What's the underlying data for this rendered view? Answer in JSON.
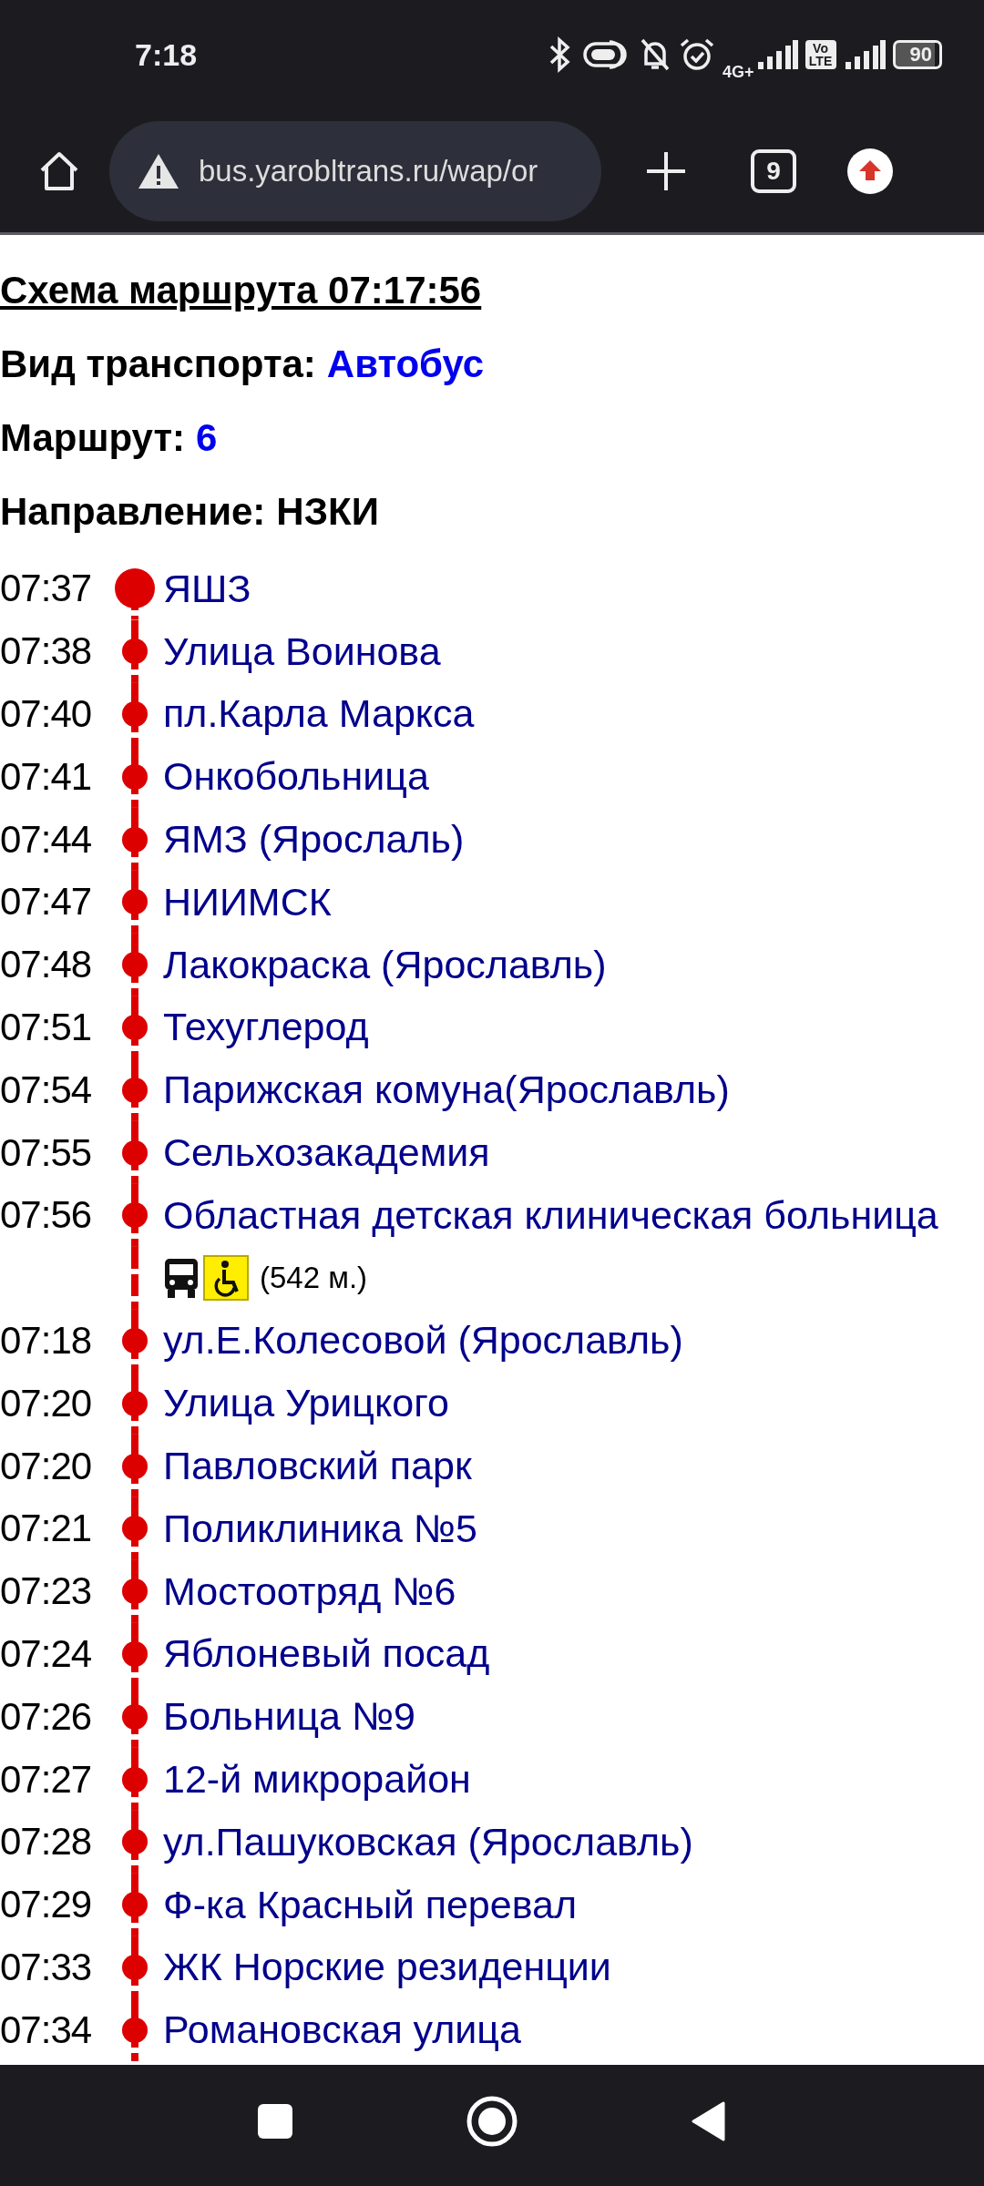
{
  "status_bar": {
    "time": "7:18",
    "network": "4G+",
    "volte": "Vo LTE",
    "battery": "90"
  },
  "browser": {
    "url": "bus.yarobltrans.ru/wap/or",
    "tab_count": "9"
  },
  "page": {
    "title": "Схема маршрута 07:17:56",
    "fields": [
      {
        "label": "Вид транспорта:",
        "value": "Автобус",
        "link": true
      },
      {
        "label": "Маршрут:",
        "value": "6",
        "link": true
      },
      {
        "label": "Направление:",
        "value": "НЗКИ",
        "link": false
      }
    ],
    "stops": [
      {
        "kind": "terminal",
        "time": "07:37",
        "name": "ЯШЗ"
      },
      {
        "kind": "stop",
        "time": "07:38",
        "name": "Улица Воинова"
      },
      {
        "kind": "stop",
        "time": "07:40",
        "name": "пл.Карла Маркса"
      },
      {
        "kind": "stop",
        "time": "07:41",
        "name": "Онкобольница"
      },
      {
        "kind": "stop",
        "time": "07:44",
        "name": "ЯМЗ (Ярослаль)"
      },
      {
        "kind": "stop",
        "time": "07:47",
        "name": "НИИМСК"
      },
      {
        "kind": "stop",
        "time": "07:48",
        "name": "Лакокраска (Ярославль)"
      },
      {
        "kind": "stop",
        "time": "07:51",
        "name": "Техуглерод"
      },
      {
        "kind": "stop",
        "time": "07:54",
        "name": "Парижская комуна(Ярославль)"
      },
      {
        "kind": "stop",
        "time": "07:55",
        "name": "Сельхозакадемия"
      },
      {
        "kind": "stop",
        "time": "07:56",
        "name": "Областная детская клиническая больница"
      },
      {
        "kind": "vehicle",
        "accessible": true,
        "distance": "(542 м.)"
      },
      {
        "kind": "stop",
        "time": "07:18",
        "name": "ул.Е.Колесовой (Ярославль)"
      },
      {
        "kind": "stop",
        "time": "07:20",
        "name": "Улица Урицкого"
      },
      {
        "kind": "stop",
        "time": "07:20",
        "name": "Павловский парк"
      },
      {
        "kind": "stop",
        "time": "07:21",
        "name": "Поликлиника №5"
      },
      {
        "kind": "stop",
        "time": "07:23",
        "name": "Мостоотряд №6"
      },
      {
        "kind": "stop",
        "time": "07:24",
        "name": "Яблоневый посад"
      },
      {
        "kind": "stop",
        "time": "07:26",
        "name": "Больница №9"
      },
      {
        "kind": "stop",
        "time": "07:27",
        "name": "12-й микрорайон"
      },
      {
        "kind": "stop",
        "time": "07:28",
        "name": "ул.Пашуковская (Ярославль)"
      },
      {
        "kind": "stop",
        "time": "07:29",
        "name": "Ф-ка Красный перевал"
      },
      {
        "kind": "stop",
        "time": "07:33",
        "name": "ЖК Норские резиденции"
      },
      {
        "kind": "stop",
        "time": "07:34",
        "name": "Романовская улица"
      }
    ]
  }
}
